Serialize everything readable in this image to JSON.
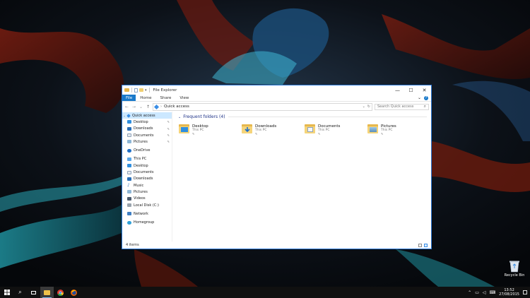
{
  "window": {
    "title": "File Explorer",
    "buttons": {
      "minimize": "—",
      "maximize": "☐",
      "close": "✕"
    }
  },
  "ribbon": {
    "tabs": [
      "File",
      "Home",
      "Share",
      "View"
    ]
  },
  "address": {
    "path": "Quick access",
    "search_placeholder": "Search Quick access"
  },
  "nav": {
    "quick_access": "Quick access",
    "qa_items": [
      "Desktop",
      "Downloads",
      "Documents",
      "Pictures"
    ],
    "onedrive": "OneDrive",
    "this_pc": "This PC",
    "pc_items": [
      "Desktop",
      "Documents",
      "Downloads",
      "Music",
      "Pictures",
      "Videos",
      "Local Disk (C:)"
    ],
    "network": "Network",
    "homegroup": "Homegroup"
  },
  "main": {
    "group_title": "Frequent folders (4)",
    "tiles": [
      {
        "name": "Desktop",
        "location": "This PC"
      },
      {
        "name": "Downloads",
        "location": "This PC"
      },
      {
        "name": "Documents",
        "location": "This PC"
      },
      {
        "name": "Pictures",
        "location": "This PC"
      }
    ]
  },
  "status": {
    "item_count": "4 items"
  },
  "desktop": {
    "recycle_bin": "Recycle Bin"
  },
  "taskbar": {
    "time": "13:52",
    "date": "27/08/2015"
  },
  "colors": {
    "accent": "#1979ca",
    "selection": "#cce8ff",
    "group_title": "#1e3287",
    "folder": "#f5d47a",
    "taskbar": "#101010"
  }
}
